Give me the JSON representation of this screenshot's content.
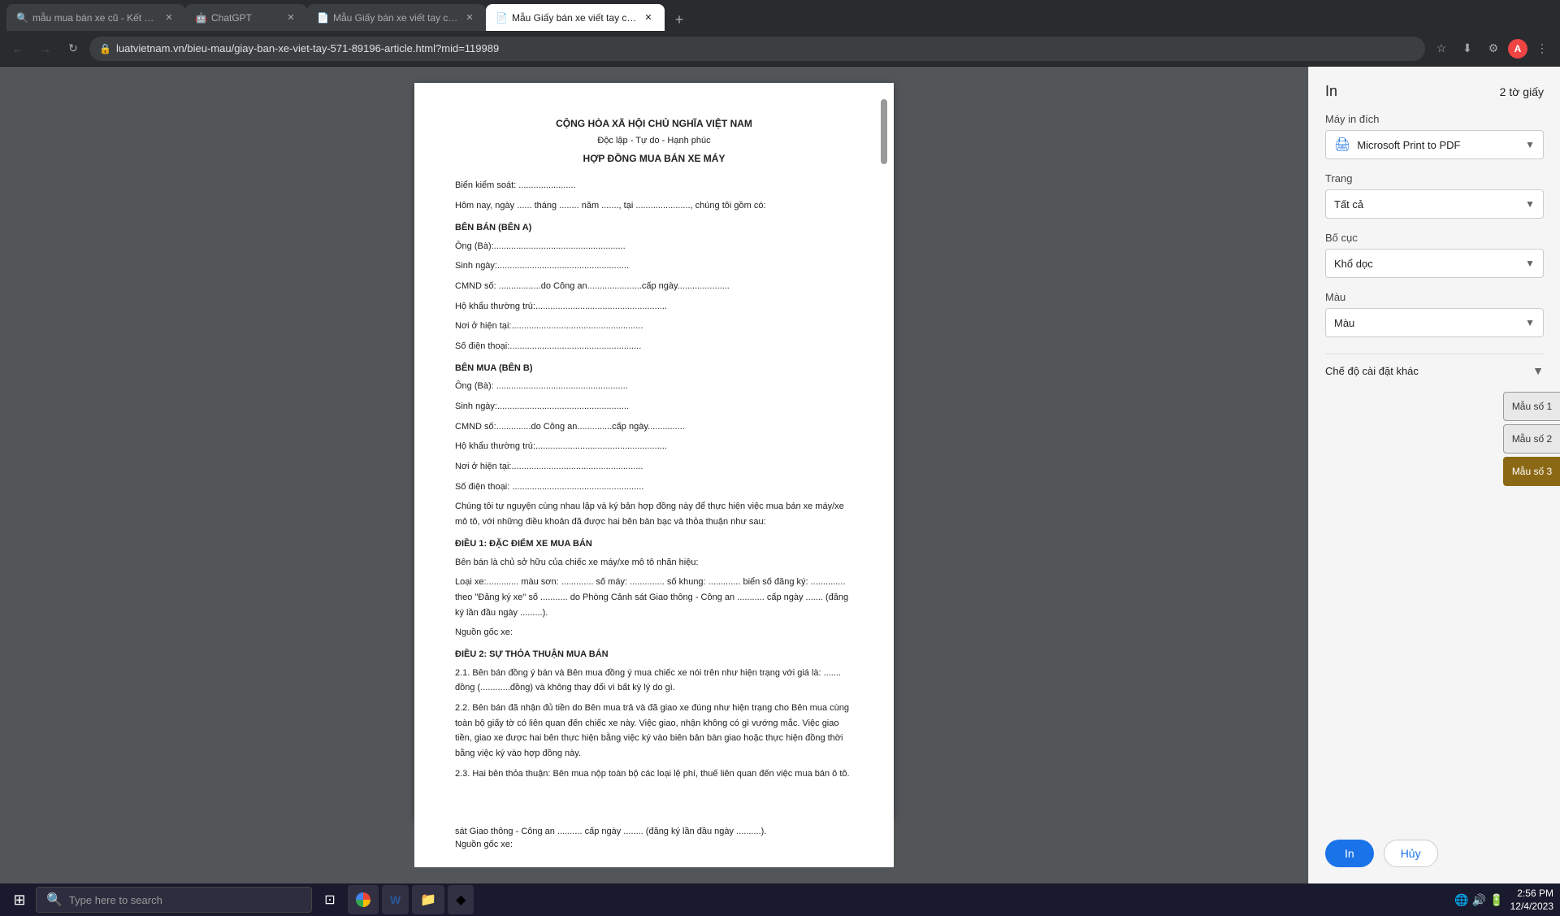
{
  "browser": {
    "tabs": [
      {
        "id": "tab1",
        "title": "mẫu mua bán xe cũ - Kết quả t...",
        "favicon": "🔍",
        "active": false,
        "closeable": true
      },
      {
        "id": "tab2",
        "title": "ChatGPT",
        "favicon": "🤖",
        "active": false,
        "closeable": true
      },
      {
        "id": "tab3",
        "title": "Mẫu Giấy bán xe viết tay chuẩ...",
        "favicon": "📄",
        "active": false,
        "closeable": true
      },
      {
        "id": "tab4",
        "title": "Mẫu Giấy bán xe viết tay chuẩ...",
        "favicon": "📄",
        "active": true,
        "closeable": true
      }
    ],
    "url": "luatvietnam.vn/bieu-mau/giay-ban-xe-viet-tay-571-89196-article.html?mid=119989",
    "nav": {
      "back": false,
      "forward": false,
      "refresh": true
    }
  },
  "print_panel": {
    "title": "In",
    "pages_label": "2 tờ giấy",
    "printer_label": "Máy in đích",
    "printer_value": "Microsoft Print to PDF",
    "pages_field_label": "Trang",
    "pages_field_value": "Tất cả",
    "layout_label": "Bố cục",
    "layout_value": "Khổ dọc",
    "color_label": "Màu",
    "color_value": "Màu",
    "advanced_label": "Chế độ cài đặt khác",
    "btn_print": "In",
    "btn_cancel": "Hủy"
  },
  "document": {
    "header_line1": "CỘNG HÒA XÃ HỘI CHỦ NGHĨA VIỆT NAM",
    "header_line2": "Độc lập - Tự do - Hạnh phúc",
    "main_title": "HỢP ĐỒNG MUA BÁN XE MÁY",
    "lines": [
      "Biển kiểm soát: .......................",
      "Hôm nay, ngày ...... tháng ........ năm ......., tại ......................, chúng tôi gồm có:",
      "BÊN BÁN (BÊN A)",
      "Ông (Bà):.....................................................",
      "Sinh ngày:.....................................................",
      "CMND số: .................do Công an......................cấp ngày.....................",
      "Hộ khẩu thường trú:.....................................................",
      "Nơi ở hiện tại:.....................................................",
      "Số điện thoại:.....................................................",
      "BÊN MUA (BÊN B)",
      "Ông (Bà): .....................................................",
      "Sinh ngày:.....................................................",
      "CMND số:..............do Công an..............cấp ngày...............",
      "Hộ khẩu thường trú:.....................................................",
      "Nơi ở hiện tại:.....................................................",
      "Số điện thoại: .....................................................",
      "Chúng tôi tự nguyện cùng nhau lập và ký bản hợp đồng này để thực hiện việc mua bán xe máy/xe mô tô, với những điều khoản đã được hai bên bàn bạc và thỏa thuận như sau:",
      "ĐIỀU 1: ĐẶC ĐIỂM XE MUA BÁN",
      "Bên bán là chủ sở hữu của chiếc xe máy/xe mô tô nhãn hiệu:",
      "Loại xe:............. màu sơn: ............. số máy: .............. số khung: ............. biển số đăng ký: .............. theo \"Đăng ký xe\" số ........... do Phòng Cảnh sát Giao thông - Công an ........... cấp ngày ....... (đăng ký lần đầu ngày .........).",
      "Nguồn gốc xe:",
      "ĐIỀU 2: SỰ THỎA THUẬN MUA BÁN",
      "2.1. Bên bán đồng ý bán và Bên mua đồng ý mua chiếc xe nói trên như hiện trạng với giá là: ....... đồng (............đồng) và không thay đổi vì bất kỳ lý do gì.",
      "2.2. Bên bán đã nhận đủ tiền do Bên mua trả và đã giao xe đúng như hiện trạng cho Bên mua cùng toàn bộ giấy tờ có liên quan đến chiếc xe này. Việc giao, nhận không có gì vướng mắc. Việc giao tiền, giao xe được hai bên thực hiện bằng việc ký vào biên bản bàn giao hoặc thực hiện đồng thời bằng việc ký vào hợp đồng này.",
      "2.3. Hai bên thỏa thuận: Bên mua nộp toàn bộ các loại lệ phí, thuế liên quan đến việc mua bán ô tô."
    ]
  },
  "sample_buttons": [
    {
      "label": "Mẫu số 1",
      "type": "light"
    },
    {
      "label": "Mẫu số 2",
      "type": "light"
    },
    {
      "label": "Mẫu số 3",
      "type": "dark"
    }
  ],
  "taskbar": {
    "search_placeholder": "Type here to search",
    "time": "2:56 PM",
    "date": "12/4/2023",
    "apps": [
      {
        "label": "Windows",
        "icon": "⊞"
      },
      {
        "label": "File Explorer",
        "icon": "📁"
      },
      {
        "label": "Chrome",
        "icon": "●"
      },
      {
        "label": "Word",
        "icon": "W"
      },
      {
        "label": "Files",
        "icon": "📂"
      },
      {
        "label": "App",
        "icon": "◆"
      }
    ]
  }
}
